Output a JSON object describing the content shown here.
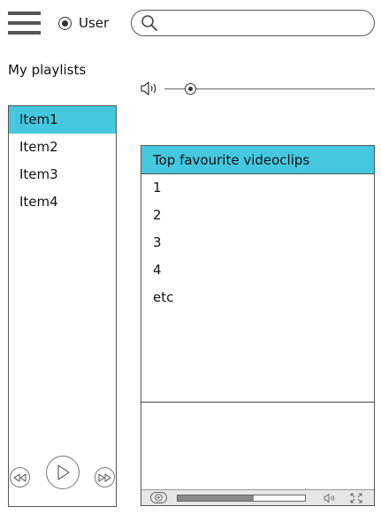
{
  "header": {
    "user_label": "User",
    "search_value": "",
    "search_placeholder": ""
  },
  "sidebar": {
    "title": "My playlists",
    "items": [
      {
        "label": "Item1",
        "selected": true
      },
      {
        "label": "Item2",
        "selected": false
      },
      {
        "label": "Item3",
        "selected": false
      },
      {
        "label": "Item4",
        "selected": false
      }
    ]
  },
  "volume": {
    "level_fraction": 0.12
  },
  "clips_panel": {
    "title": "Top favourite videoclips",
    "items": [
      "1",
      "2",
      "3",
      "4",
      "etc"
    ]
  },
  "player": {
    "progress_fraction": 0.6
  },
  "icons": {
    "menu": "hamburger-menu-icon",
    "search": "search-icon",
    "volume": "speaker-icon",
    "prev": "rewind-icon",
    "play": "play-icon",
    "next": "fast-forward-icon",
    "fullscreen": "fullscreen-icon"
  },
  "colors": {
    "accent": "#45c8df",
    "border": "#555555"
  }
}
